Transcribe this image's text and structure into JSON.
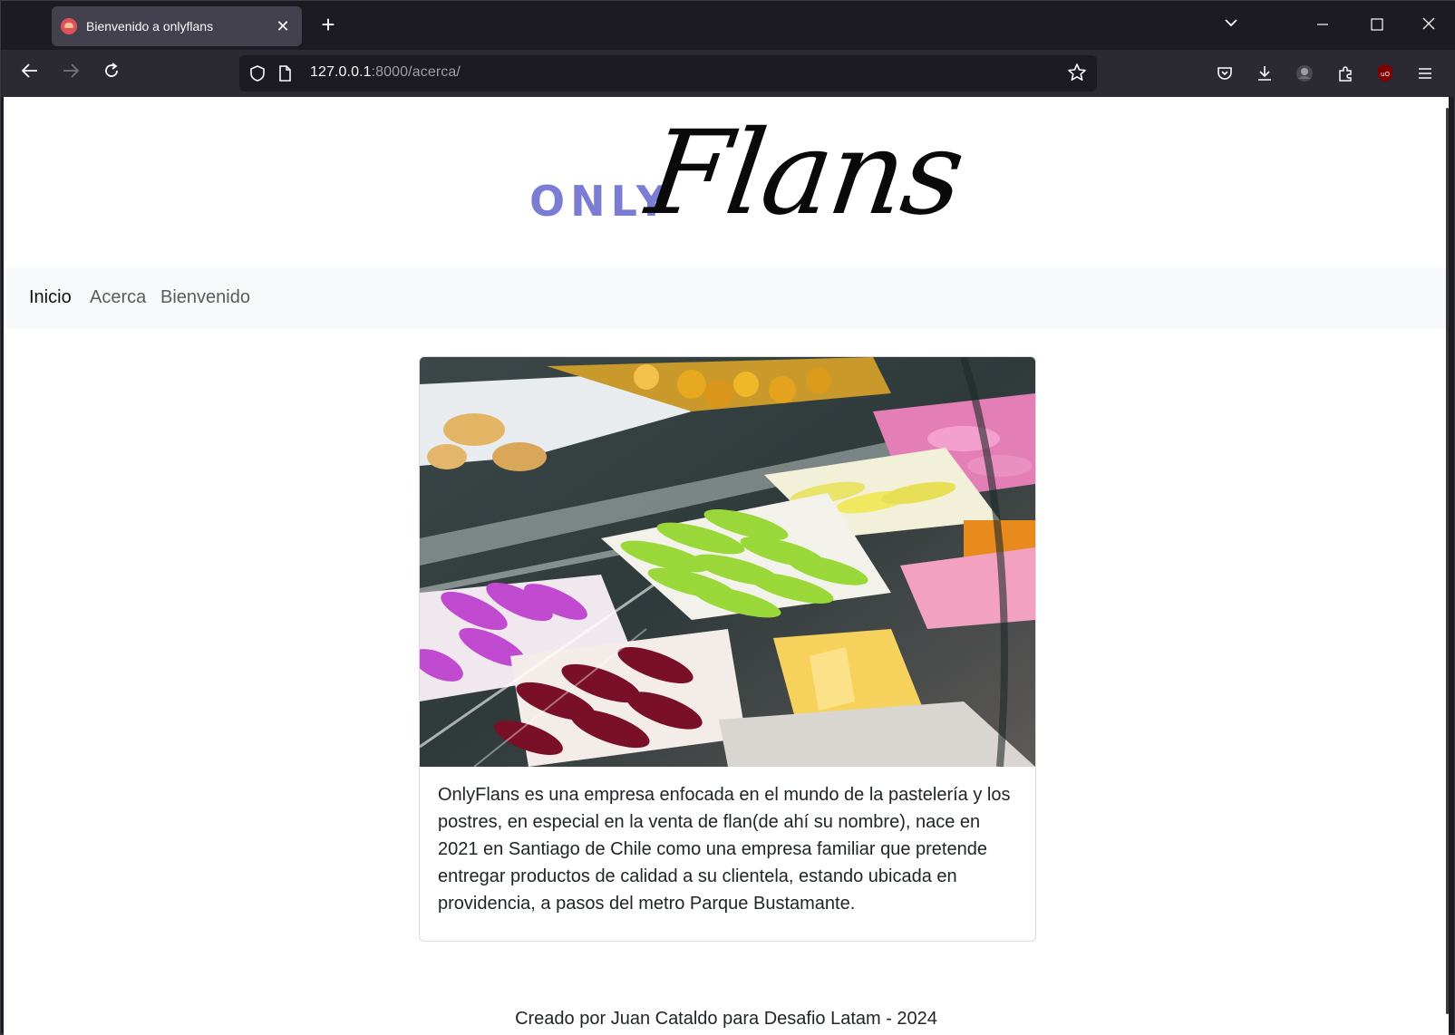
{
  "browser": {
    "tab": {
      "title": "Bienvenido a onlyflans",
      "close_label": "✕"
    },
    "new_tab_label": "+",
    "url": {
      "host": "127.0.0.1",
      "rest": ":8000/acerca/"
    }
  },
  "logo": {
    "only": "ONLY",
    "flans": "Flans"
  },
  "nav": {
    "items": [
      {
        "label": "Inicio"
      },
      {
        "label": "Acerca"
      },
      {
        "label": "Bienvenido"
      }
    ]
  },
  "card": {
    "text": "OnlyFlans es una empresa enfocada en el mundo de la pastelería y los postres, en especial en la venta de flan(de ahí su nombre), nace en 2021 en Santiago de Chile como una empresa familiar que pretende entregar productos de calidad a su clientela, estando ubicada en providencia, a pasos del metro Parque Bustamante."
  },
  "footer": {
    "text": "Creado por Juan Cataldo para Desafio Latam - 2024"
  }
}
